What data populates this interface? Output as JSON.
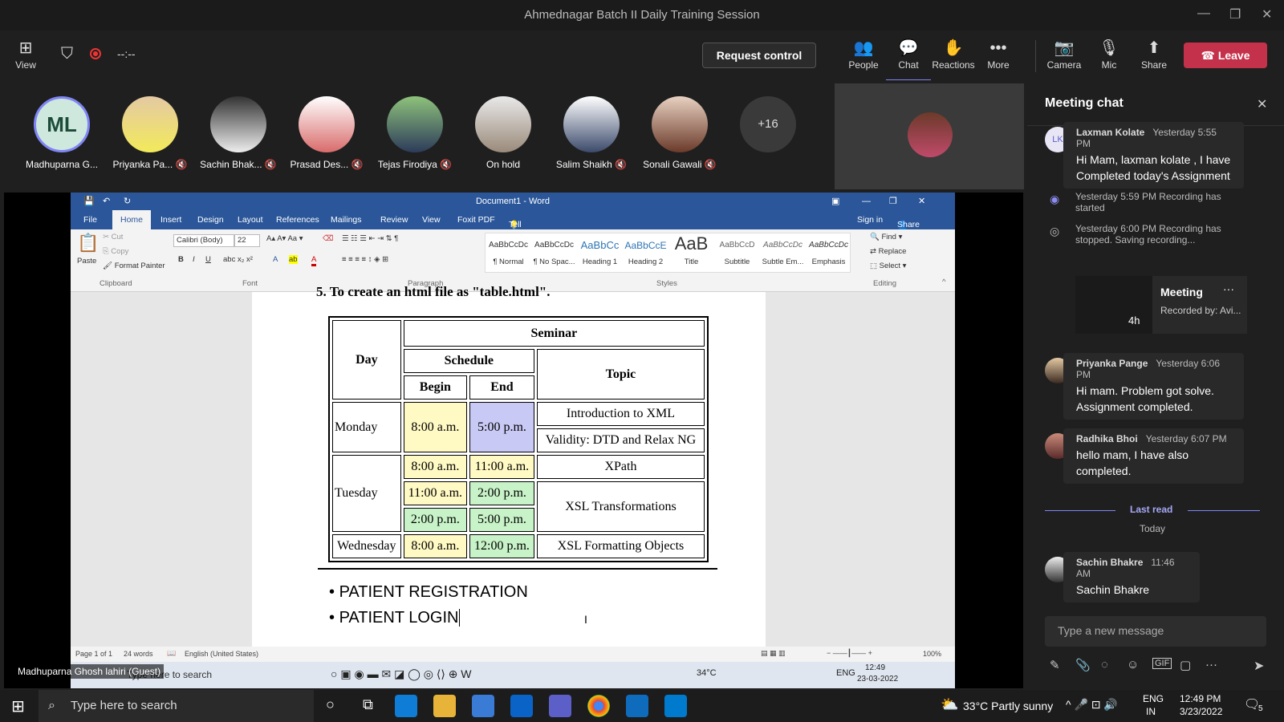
{
  "window": {
    "title": "Ahmednagar Batch II Daily Training Session"
  },
  "toolbar": {
    "view": "View",
    "timer": "--:--",
    "request_control": "Request control",
    "people": "People",
    "chat": "Chat",
    "reactions": "Reactions",
    "more": "More",
    "camera": "Camera",
    "mic": "Mic",
    "share": "Share",
    "leave": "Leave"
  },
  "participants": [
    {
      "initials": "ML",
      "name": "Madhuparna G..."
    },
    {
      "name": "Priyanka Pa..."
    },
    {
      "name": "Sachin Bhak..."
    },
    {
      "name": "Prasad Des..."
    },
    {
      "name": "Tejas Firodiya"
    },
    {
      "name": "On hold"
    },
    {
      "name": "Salim Shaikh"
    },
    {
      "name": "Sonali Gawali"
    },
    {
      "name": "+16"
    }
  ],
  "presenter_label": "Madhuparna Ghosh lahiri (Guest)",
  "word": {
    "title": "Document1 - Word",
    "menu": [
      "File",
      "Home",
      "Insert",
      "Design",
      "Layout",
      "References",
      "Mailings",
      "Review",
      "View",
      "Foxit PDF"
    ],
    "tell_me": "Tell me what you want to do...",
    "sign_in": "Sign in",
    "share": "Share",
    "clipboard": {
      "paste": "Paste",
      "cut": "Cut",
      "copy": "Copy",
      "format_painter": "Format Painter",
      "group": "Clipboard"
    },
    "font": {
      "name": "Calibri (Body)",
      "size": "22",
      "group": "Font"
    },
    "paragraph_group": "Paragraph",
    "styles": [
      {
        "preview": "AaBbCcDc",
        "label": "¶ Normal"
      },
      {
        "preview": "AaBbCcDc",
        "label": "¶ No Spac..."
      },
      {
        "preview": "AaBbCc",
        "label": "Heading 1"
      },
      {
        "preview": "AaBbCcE",
        "label": "Heading 2"
      },
      {
        "preview": "AaB",
        "label": "Title"
      },
      {
        "preview": "AaBbCcD",
        "label": "Subtitle"
      },
      {
        "preview": "AaBbCcDc",
        "label": "Subtle Em..."
      },
      {
        "preview": "AaBbCcDc",
        "label": "Emphasis"
      }
    ],
    "styles_group": "Styles",
    "editing": {
      "find": "Find",
      "replace": "Replace",
      "select": "Select",
      "group": "Editing"
    },
    "doc_heading_partial": "5. To create an html file as \"table.html\".",
    "table": {
      "seminar": "Seminar",
      "day": "Day",
      "schedule": "Schedule",
      "begin": "Begin",
      "end": "End",
      "topic": "Topic",
      "monday": "Monday",
      "mon_begin": "8:00 a.m.",
      "mon_end": "5:00 p.m.",
      "mon_topic1": "Introduction to XML",
      "mon_topic2": "Validity: DTD and Relax NG",
      "tuesday": "Tuesday",
      "tue_r1_begin": "8:00 a.m.",
      "tue_r1_end": "11:00 a.m.",
      "tue_r2_begin": "11:00 a.m.",
      "tue_r2_end": "2:00 p.m.",
      "tue_r3_begin": "2:00 p.m.",
      "tue_r3_end": "5:00 p.m.",
      "tue_topic1": "XPath",
      "tue_topic2": "XSL Transformations",
      "wednesday": "Wednesday",
      "wed_begin": "8:00 a.m.",
      "wed_end": "12:00 p.m.",
      "wed_topic": "XSL Formatting Objects"
    },
    "bullets": [
      "PATIENT REGISTRATION",
      "PATIENT LOGIN"
    ],
    "status": {
      "page": "Page 1 of 1",
      "words": "24 words",
      "lang": "English (United States)",
      "zoom": "100%"
    },
    "inner_taskbar": {
      "search": "Type here to search",
      "temp": "34°C",
      "lang": "ENG",
      "time": "12:49",
      "date": "23-03-2022"
    }
  },
  "chat": {
    "title": "Meeting chat",
    "messages": [
      {
        "initials": "LK",
        "name": "Laxman Kolate",
        "time": "Yesterday 5:55 PM",
        "text": "Hi Mam, laxman kolate , I have Completed today's Assignment"
      },
      {
        "name": "Priyanka Pange",
        "time": "Yesterday 6:06 PM",
        "text": "Hi mam. Problem got solve. Assignment completed."
      },
      {
        "name": "Radhika Bhoi",
        "time": "Yesterday 6:07 PM",
        "text": "hello mam, I have also completed."
      },
      {
        "name": "Sachin Bhakre",
        "time": "11:46 AM",
        "text": "Sachin Bhakre"
      }
    ],
    "events": [
      {
        "time": "Yesterday 5:59 PM",
        "text": "Recording has started"
      },
      {
        "time": "Yesterday 6:00 PM",
        "text": "Recording has stopped. Saving recording..."
      }
    ],
    "recording_card": {
      "title": "Meeting",
      "subtitle": "Recorded by: Avi...",
      "duration": "4h"
    },
    "last_read": "Last read",
    "today": "Today",
    "input_placeholder": "Type a new message"
  },
  "taskbar": {
    "search": "Type here to search",
    "weather": "33°C  Partly sunny",
    "lang": "ENG",
    "region": "IN",
    "time": "12:49 PM",
    "date": "3/23/2022",
    "notifications": "5"
  }
}
